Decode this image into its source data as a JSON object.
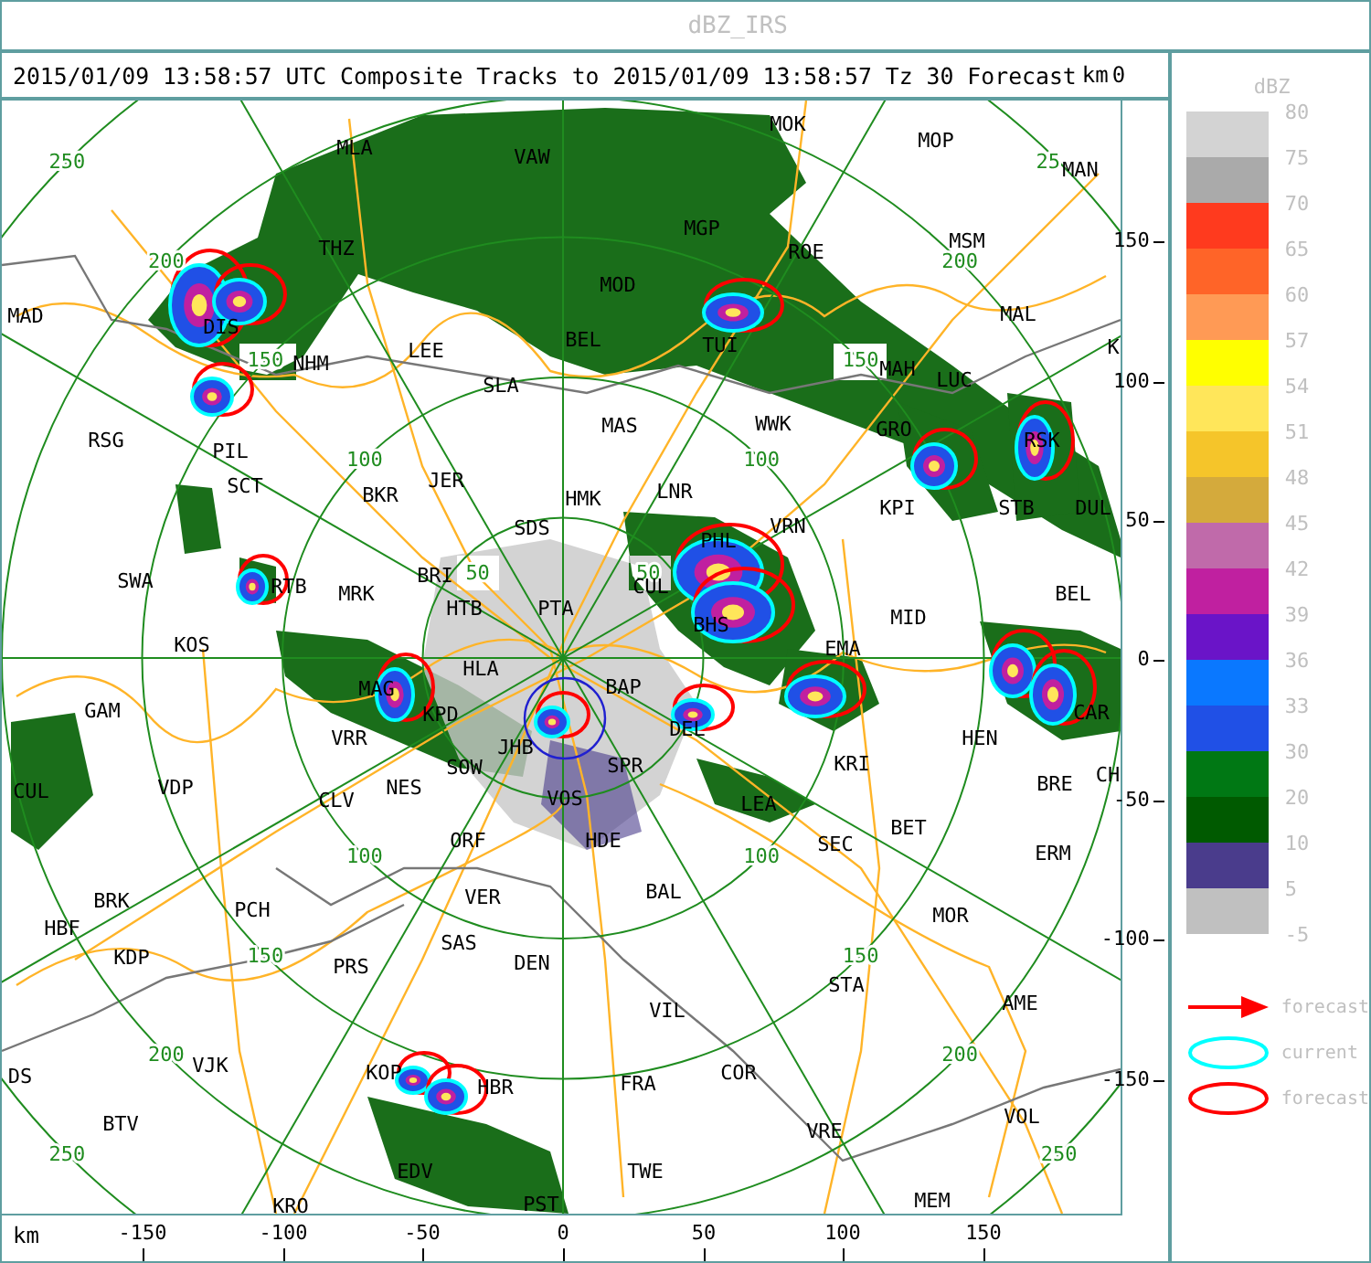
{
  "window": {
    "title": "dBZ_IRS"
  },
  "header": {
    "title": "2015/01/09 13:58:57 UTC Composite Tracks to 2015/01/09 13:58:57 Tz 30 Forecast",
    "y_unit": "km",
    "y_top_label": "0"
  },
  "map": {
    "stations": [
      "MOK",
      "MOP",
      "MLA",
      "VAW",
      "MAN",
      "MGP",
      "MSM",
      "THZ",
      "ROE",
      "MOD",
      "MAD",
      "MAL",
      "DIS",
      "LEE",
      "BEL",
      "TUI",
      "K",
      "NHM",
      "MAH",
      "LUC",
      "SLA",
      "MAS",
      "WWK",
      "GRO",
      "RSG",
      "RSK",
      "PIL",
      "JER",
      "SCT",
      "BKR",
      "HMK",
      "LNR",
      "KPI",
      "STB",
      "DUL",
      "VRN",
      "SDS",
      "PHL",
      "BRI",
      "SWA",
      "RTB",
      "CUL",
      "MRK",
      "BEL",
      "HTB",
      "PTA",
      "MID",
      "BHS",
      "KOS",
      "EMA",
      "HLA",
      "BAP",
      "MAG",
      "GAM",
      "KPD",
      "CAR",
      "VRR",
      "JHB",
      "DEL",
      "HEN",
      "SOW",
      "SPR",
      "KRI",
      "CH",
      "CUL",
      "VDP",
      "CLV",
      "NES",
      "VOS",
      "LEA",
      "BRE",
      "BET",
      "ORF",
      "HDE",
      "SEC",
      "ERM",
      "BRK",
      "PCH",
      "VER",
      "BAL",
      "MOR",
      "HBF",
      "SAS",
      "KDP",
      "PRS",
      "DEN",
      "VIL",
      "STA",
      "AME",
      "DS",
      "VJK",
      "KOP",
      "HBR",
      "FRA",
      "COR",
      "BTV",
      "VRE",
      "VOL",
      "EDV",
      "TWE",
      "KRO",
      "PST",
      "MEM"
    ],
    "range_labels": [
      "250",
      "25",
      "200",
      "200",
      "150",
      "150",
      "100",
      "100",
      "50",
      "50",
      "100",
      "100",
      "150",
      "150",
      "200",
      "200",
      "250",
      "250"
    ]
  },
  "y_axis": {
    "ticks": [
      "150",
      "100",
      "50",
      "0",
      "-50",
      "-100",
      "-150"
    ]
  },
  "x_axis": {
    "unit": "km",
    "ticks": [
      "-150",
      "-100",
      "-50",
      "0",
      "50",
      "100",
      "150"
    ]
  },
  "legend": {
    "title": "dBZ",
    "swatches": [
      {
        "color": "#d3d3d3"
      },
      {
        "color": "#aaaaaa"
      },
      {
        "color": "#ff3a1e"
      },
      {
        "color": "#ff6428"
      },
      {
        "color": "#ff9a55"
      },
      {
        "color": "#ffff00"
      },
      {
        "color": "#ffe65a"
      },
      {
        "color": "#f5c52a"
      },
      {
        "color": "#d4aa3c"
      },
      {
        "color": "#c06aaa"
      },
      {
        "color": "#c020a0"
      },
      {
        "color": "#6a14c8"
      },
      {
        "color": "#0a78ff"
      },
      {
        "color": "#2050e6"
      },
      {
        "color": "#007814"
      },
      {
        "color": "#005a00"
      },
      {
        "color": "#4a3c8c"
      },
      {
        "color": "#c0c0c0"
      }
    ],
    "labels": [
      "80",
      "75",
      "70",
      "65",
      "60",
      "57",
      "54",
      "51",
      "48",
      "45",
      "42",
      "39",
      "36",
      "33",
      "30",
      "20",
      "10",
      "5",
      "-5"
    ],
    "symbols": [
      {
        "kind": "arrow",
        "color": "#ff0000",
        "label": "forecast"
      },
      {
        "kind": "ellipse",
        "color": "#00ffff",
        "label": "current"
      },
      {
        "kind": "ellipse",
        "color": "#ff0000",
        "label": "forecast"
      }
    ]
  }
}
